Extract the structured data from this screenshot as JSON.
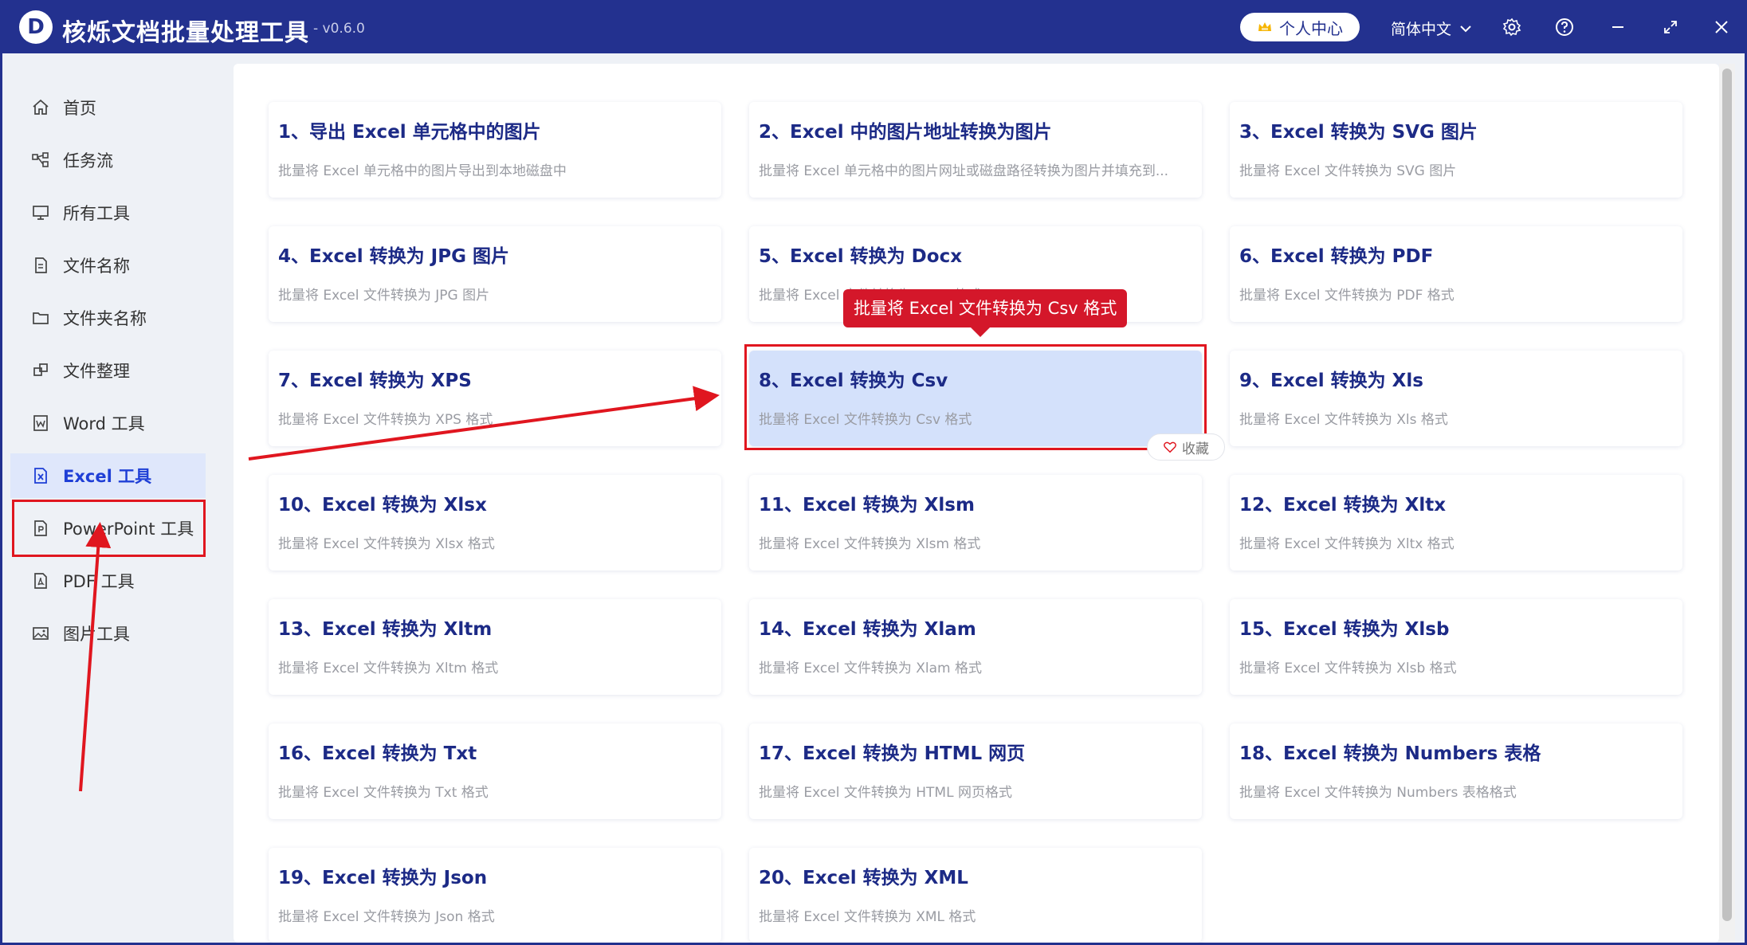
{
  "app": {
    "logo_letter": "D",
    "title": "核烁文档批量处理工具",
    "version": "- v0.6.0",
    "user_center": "个人中心",
    "language": "简体中文"
  },
  "sidebar": {
    "items": [
      {
        "label": "首页",
        "icon": "home-icon"
      },
      {
        "label": "任务流",
        "icon": "workflow-icon"
      },
      {
        "label": "所有工具",
        "icon": "monitor-icon"
      },
      {
        "label": "文件名称",
        "icon": "file-icon"
      },
      {
        "label": "文件夹名称",
        "icon": "folder-icon"
      },
      {
        "label": "文件整理",
        "icon": "organize-icon"
      },
      {
        "label": "Word 工具",
        "icon": "word-icon"
      },
      {
        "label": "Excel 工具",
        "icon": "excel-icon",
        "active": true
      },
      {
        "label": "PowerPoint 工具",
        "icon": "powerpoint-icon"
      },
      {
        "label": "PDF 工具",
        "icon": "pdf-icon"
      },
      {
        "label": "图片工具",
        "icon": "image-icon"
      }
    ]
  },
  "tools": [
    {
      "title": "1、导出 Excel 单元格中的图片",
      "desc": "批量将 Excel 单元格中的图片导出到本地磁盘中"
    },
    {
      "title": "2、Excel 中的图片地址转换为图片",
      "desc": "批量将 Excel 单元格中的图片网址或磁盘路径转换为图片并填充到..."
    },
    {
      "title": "3、Excel 转换为 SVG 图片",
      "desc": "批量将 Excel 文件转换为 SVG 图片"
    },
    {
      "title": "4、Excel 转换为 JPG 图片",
      "desc": "批量将 Excel 文件转换为 JPG 图片"
    },
    {
      "title": "5、Excel 转换为 Docx",
      "desc": "批量将 Excel 文件转换为 Docx 格式"
    },
    {
      "title": "6、Excel 转换为 PDF",
      "desc": "批量将 Excel 文件转换为 PDF 格式"
    },
    {
      "title": "7、Excel 转换为 XPS",
      "desc": "批量将 Excel 文件转换为 XPS 格式"
    },
    {
      "title": "8、Excel 转换为 Csv",
      "desc": "批量将 Excel 文件转换为 Csv 格式",
      "selected": true
    },
    {
      "title": "9、Excel 转换为 Xls",
      "desc": "批量将 Excel 文件转换为 Xls 格式"
    },
    {
      "title": "10、Excel 转换为 Xlsx",
      "desc": "批量将 Excel 文件转换为 Xlsx 格式"
    },
    {
      "title": "11、Excel 转换为 Xlsm",
      "desc": "批量将 Excel 文件转换为 Xlsm 格式"
    },
    {
      "title": "12、Excel 转换为 Xltx",
      "desc": "批量将 Excel 文件转换为 Xltx 格式"
    },
    {
      "title": "13、Excel 转换为 Xltm",
      "desc": "批量将 Excel 文件转换为 Xltm 格式"
    },
    {
      "title": "14、Excel 转换为 Xlam",
      "desc": "批量将 Excel 文件转换为 Xlam 格式"
    },
    {
      "title": "15、Excel 转换为 Xlsb",
      "desc": "批量将 Excel 文件转换为 Xlsb 格式"
    },
    {
      "title": "16、Excel 转换为 Txt",
      "desc": "批量将 Excel 文件转换为 Txt 格式"
    },
    {
      "title": "17、Excel 转换为 HTML 网页",
      "desc": "批量将 Excel 文件转换为 HTML 网页格式"
    },
    {
      "title": "18、Excel 转换为 Numbers 表格",
      "desc": "批量将 Excel 文件转换为 Numbers 表格格式"
    },
    {
      "title": "19、Excel 转换为 Json",
      "desc": "批量将 Excel 文件转换为 Json 格式"
    },
    {
      "title": "20、Excel 转换为 XML",
      "desc": "批量将 Excel 文件转换为 XML 格式"
    }
  ],
  "tooltip": "批量将 Excel 文件转换为 Csv 格式",
  "favorite_label": "收藏",
  "colors": {
    "titlebar": "#23318f",
    "accent": "#1f3fd6",
    "annotation_red": "#e0161f",
    "selected_card": "#d4e1fb"
  }
}
